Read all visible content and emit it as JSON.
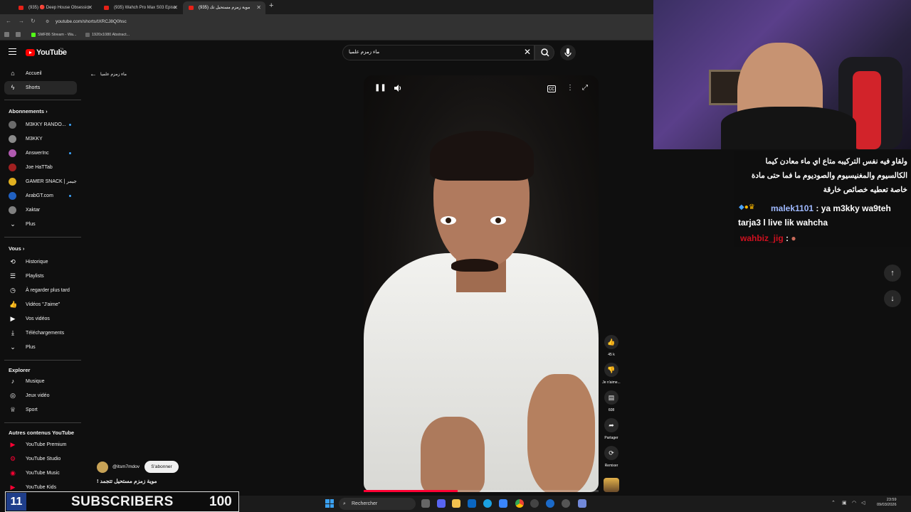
{
  "browser": {
    "tabs": [
      {
        "label": "(935) 🔴 Deep House Obsessio"
      },
      {
        "label": "(935) Wahch Pro Max S03 Episo"
      },
      {
        "label": "(935) موية زمزم مستحيل تك"
      }
    ],
    "url": "youtube.com/shorts/tXRCJ8Q0hsc",
    "bookmarks": [
      "SMF86 Stream - Wa...",
      "1920x1080 Abstract..."
    ]
  },
  "youtube": {
    "logo_text": "YouTube",
    "logo_sup": "TN",
    "search_value": "ماء زمزم علميا",
    "back_title": "ماء زمزم علميا"
  },
  "sidebar": {
    "main": [
      {
        "label": "Accueil",
        "icon": "home-icon"
      },
      {
        "label": "Shorts",
        "icon": "shorts-icon"
      }
    ],
    "subs_heading": "Abonnements",
    "subs": [
      {
        "label": "M3KKY RANDO...",
        "color": "#6b6b6b"
      },
      {
        "label": "M3KKY",
        "color": "#8a8a8a"
      },
      {
        "label": "AnswerInc",
        "color": "#b05ab0"
      },
      {
        "label": "Joe HaTTab",
        "color": "#a02020"
      },
      {
        "label": "GAMER SNACK | جيمر",
        "color": "#e0b020"
      },
      {
        "label": "ArabGT.com",
        "color": "#2060c0"
      },
      {
        "label": "Xaktar",
        "color": "#808080"
      },
      {
        "label": "Plus",
        "color": ""
      }
    ],
    "you_heading": "Vous",
    "you": [
      {
        "label": "Historique",
        "icon": "history-icon"
      },
      {
        "label": "Playlists",
        "icon": "playlist-icon"
      },
      {
        "label": "À regarder plus tard",
        "icon": "clock-icon"
      },
      {
        "label": "Vidéos \"J'aime\"",
        "icon": "like-icon"
      },
      {
        "label": "Vos vidéos",
        "icon": "video-icon"
      },
      {
        "label": "Téléchargements",
        "icon": "download-icon"
      },
      {
        "label": "Plus",
        "icon": "chevron-down-icon"
      }
    ],
    "explore_heading": "Explorer",
    "explore": [
      {
        "label": "Musique",
        "icon": "music-icon"
      },
      {
        "label": "Jeux vidéo",
        "icon": "gamepad-icon"
      },
      {
        "label": "Sport",
        "icon": "trophy-icon"
      }
    ],
    "other_heading": "Autres contenus YouTube",
    "other": [
      {
        "label": "YouTube Premium"
      },
      {
        "label": "YouTube Studio"
      },
      {
        "label": "YouTube Music"
      },
      {
        "label": "YouTube Kids"
      }
    ]
  },
  "short": {
    "likes": "45 k",
    "dislike_label": "Je n'aime...",
    "comments": "608",
    "share_label": "Partager",
    "remix_label": "Remixer",
    "channel": "@itsm7mdov",
    "subscribe_label": "S'abonner",
    "title": "موية زمزم مستحيل تتجمد !",
    "progress": 0.4
  },
  "stream": {
    "chat_arabic": "ولقاو فيه نفس التركيبه متاع اي ماء معادن كيما الكالسيوم والمغنيسيوم والصوديوم ما فما حتى مادة خاصة تعطيه خصائص خارقة",
    "chat_user": "malek1101",
    "chat_msg": "ya m3kky wa9teh tarja3 l live lik wahcha",
    "chat_user2": "wahbiz_jig",
    "sub_count": "11",
    "sub_label": "SUBSCRIBERS",
    "sub_goal": "100"
  },
  "taskbar": {
    "search_label": "Rechercher",
    "time": "23:59",
    "date": "09/03/2026"
  }
}
